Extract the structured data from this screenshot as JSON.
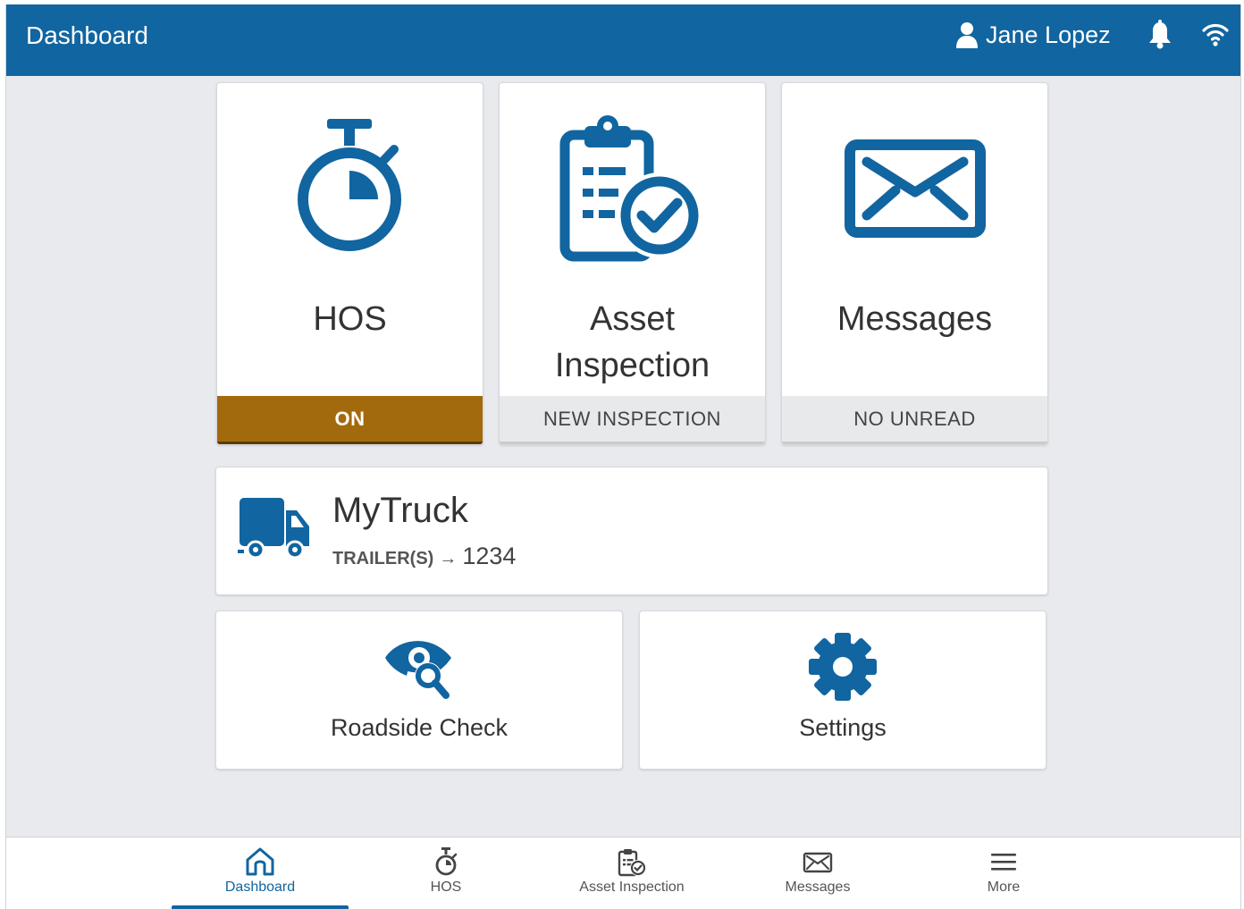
{
  "header": {
    "title": "Dashboard",
    "user_name": "Jane Lopez"
  },
  "tiles": [
    {
      "label": "HOS",
      "status": "ON",
      "icon": "stopwatch-icon"
    },
    {
      "label": "Asset\nInspection",
      "status": "NEW INSPECTION",
      "icon": "clipboard-check-icon"
    },
    {
      "label": "Messages",
      "status": "NO UNREAD",
      "icon": "envelope-icon"
    }
  ],
  "vehicle": {
    "name": "MyTruck",
    "trailer_label": "TRAILER(S)",
    "arrow": "→",
    "trailer_value": "1234",
    "icon": "truck-icon"
  },
  "actions": [
    {
      "label": "Roadside Check",
      "icon": "eye-search-icon"
    },
    {
      "label": "Settings",
      "icon": "gear-icon"
    }
  ],
  "bottom_nav": [
    {
      "label": "Dashboard",
      "icon": "home-icon",
      "active": true
    },
    {
      "label": "HOS",
      "icon": "stopwatch-icon",
      "active": false
    },
    {
      "label": "Asset Inspection",
      "icon": "clipboard-check-icon",
      "active": false
    },
    {
      "label": "Messages",
      "icon": "envelope-icon",
      "active": false
    },
    {
      "label": "More",
      "icon": "menu-icon",
      "active": false
    }
  ],
  "colors": {
    "brand_blue": "#1165a0",
    "hos_on": "#a36a0d",
    "background": "#e9eaed"
  }
}
